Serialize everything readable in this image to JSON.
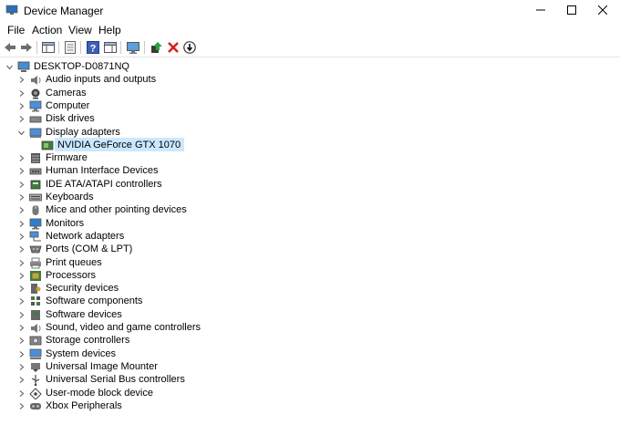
{
  "window": {
    "title": "Device Manager"
  },
  "menubar": {
    "items": [
      "File",
      "Action",
      "View",
      "Help"
    ]
  },
  "toolbar": {
    "buttons": [
      "back-icon",
      "forward-icon",
      "show-hide-console-tree-icon",
      "properties-icon",
      "help-icon",
      "action-pane-icon",
      "monitor-icon",
      "update-driver-icon",
      "uninstall-icon",
      "disable-device-icon"
    ]
  },
  "tree": {
    "root": "DESKTOP-D0871NQ",
    "categories": [
      {
        "label": "Audio inputs and outputs",
        "icon": "speaker-icon",
        "expanded": false
      },
      {
        "label": "Cameras",
        "icon": "camera-icon",
        "expanded": false
      },
      {
        "label": "Computer",
        "icon": "computer-icon",
        "expanded": false
      },
      {
        "label": "Disk drives",
        "icon": "disk-drive-icon",
        "expanded": false
      },
      {
        "label": "Display adapters",
        "icon": "display-adapter-icon",
        "expanded": true,
        "children": [
          "NVIDIA GeForce GTX 1070"
        ]
      },
      {
        "label": "Firmware",
        "icon": "firmware-icon",
        "expanded": false
      },
      {
        "label": "Human Interface Devices",
        "icon": "hid-icon",
        "expanded": false
      },
      {
        "label": "IDE ATA/ATAPI controllers",
        "icon": "ide-controller-icon",
        "expanded": false
      },
      {
        "label": "Keyboards",
        "icon": "keyboard-icon",
        "expanded": false
      },
      {
        "label": "Mice and other pointing devices",
        "icon": "mouse-icon",
        "expanded": false
      },
      {
        "label": "Monitors",
        "icon": "monitor-icon",
        "expanded": false
      },
      {
        "label": "Network adapters",
        "icon": "network-adapter-icon",
        "expanded": false
      },
      {
        "label": "Ports (COM & LPT)",
        "icon": "port-icon",
        "expanded": false
      },
      {
        "label": "Print queues",
        "icon": "printer-icon",
        "expanded": false
      },
      {
        "label": "Processors",
        "icon": "processor-icon",
        "expanded": false
      },
      {
        "label": "Security devices",
        "icon": "security-device-icon",
        "expanded": false
      },
      {
        "label": "Software components",
        "icon": "software-component-icon",
        "expanded": false
      },
      {
        "label": "Software devices",
        "icon": "software-device-icon",
        "expanded": false
      },
      {
        "label": "Sound, video and game controllers",
        "icon": "sound-icon",
        "expanded": false
      },
      {
        "label": "Storage controllers",
        "icon": "storage-controller-icon",
        "expanded": false
      },
      {
        "label": "System devices",
        "icon": "system-device-icon",
        "expanded": false
      },
      {
        "label": "Universal Image Mounter",
        "icon": "image-mounter-icon",
        "expanded": false
      },
      {
        "label": "Universal Serial Bus controllers",
        "icon": "usb-icon",
        "expanded": false
      },
      {
        "label": "User-mode block device",
        "icon": "block-device-icon",
        "expanded": false
      },
      {
        "label": "Xbox Peripherals",
        "icon": "xbox-icon",
        "expanded": false
      }
    ]
  },
  "colors": {
    "selection": "#cce8ff",
    "accent": "#1e73be"
  }
}
